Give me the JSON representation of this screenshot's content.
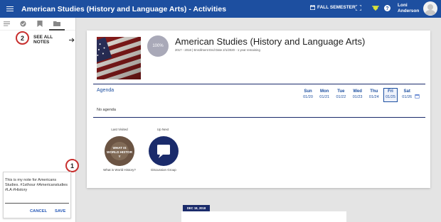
{
  "header": {
    "title": "American Studies (History and Language Arts) - Activities",
    "semester_label": "FALL SEMESTER",
    "user_first": "Loni",
    "user_last": "Anderson"
  },
  "sidebar": {
    "see_all_notes": "SEE ALL NOTES",
    "note": {
      "text": "This is my note for Americans Studies. #1sthour #Americanstudies #LA #History",
      "cancel_label": "CANCEL",
      "save_label": "SAVE"
    }
  },
  "callouts": {
    "one": "1",
    "two": "2"
  },
  "course": {
    "progress": "100%",
    "title": "American Studies (History and Language Arts)",
    "subtitle": "2017 - 2018 | Enrollment End Date 2/1/2020 - 1 year remaining"
  },
  "agenda": {
    "label": "Agenda",
    "empty_text": "No agenda",
    "days": [
      {
        "name": "Sun",
        "date": "01/20"
      },
      {
        "name": "Mon",
        "date": "01/21"
      },
      {
        "name": "Tue",
        "date": "01/22"
      },
      {
        "name": "Wed",
        "date": "01/23"
      },
      {
        "name": "Thu",
        "date": "01/24"
      },
      {
        "name": "Fri",
        "date": "01/25"
      },
      {
        "name": "Sat",
        "date": "01/26"
      }
    ],
    "active_day_index": 5
  },
  "tiles": {
    "last_visited_label": "Last Visited",
    "up_next_label": "Up Next",
    "last_visited_caption": "What is World History?",
    "last_visited_image_text": "WHAT IS WORLD HISTORY",
    "up_next_caption": "Discussion Group"
  },
  "feed": {
    "date_chip": "DEC 18, 2018"
  },
  "colors": {
    "header_blue": "#1d4fa0",
    "navy": "#1a2b6b",
    "callout_red": "#c8302f",
    "note_blue": "#2a5bb8"
  },
  "icons": [
    "menu-icon",
    "calendar-icon",
    "fullscreen-icon",
    "trophy-icon",
    "help-icon",
    "user-avatar-icon",
    "list-icon",
    "check-icon",
    "bookmark-icon",
    "folder-icon",
    "arrow-right-icon",
    "chat-bubble-icon"
  ]
}
